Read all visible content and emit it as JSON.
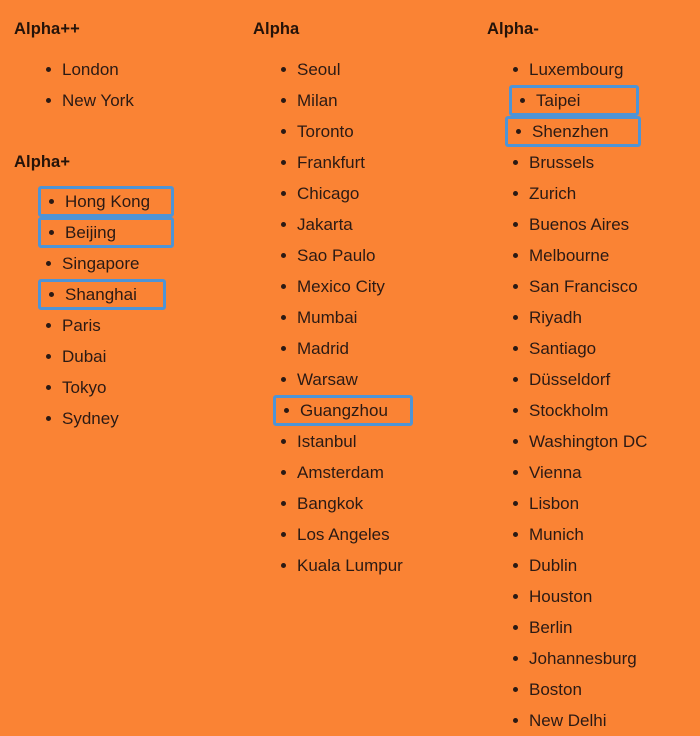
{
  "page": {
    "background_color": "#fa8334",
    "text_color": "#2b1a14",
    "highlight_color": "#4e94d6"
  },
  "columns": [
    {
      "id": "col-0",
      "groups": [
        {
          "heading": "Alpha++",
          "cities": [
            {
              "name": "London",
              "highlighted": false
            },
            {
              "name": "New York",
              "highlighted": false
            }
          ]
        },
        {
          "heading": "Alpha+",
          "cities": [
            {
              "name": "Hong Kong",
              "highlighted": true
            },
            {
              "name": "Beijing",
              "highlighted": true
            },
            {
              "name": "Singapore",
              "highlighted": false
            },
            {
              "name": "Shanghai",
              "highlighted": true
            },
            {
              "name": "Paris",
              "highlighted": false
            },
            {
              "name": "Dubai",
              "highlighted": false
            },
            {
              "name": "Tokyo",
              "highlighted": false
            },
            {
              "name": "Sydney",
              "highlighted": false
            }
          ]
        }
      ]
    },
    {
      "id": "col-1",
      "groups": [
        {
          "heading": "Alpha",
          "cities": [
            {
              "name": "Seoul",
              "highlighted": false
            },
            {
              "name": "Milan",
              "highlighted": false
            },
            {
              "name": "Toronto",
              "highlighted": false
            },
            {
              "name": "Frankfurt",
              "highlighted": false
            },
            {
              "name": "Chicago",
              "highlighted": false
            },
            {
              "name": "Jakarta",
              "highlighted": false
            },
            {
              "name": "Sao Paulo",
              "highlighted": false
            },
            {
              "name": "Mexico City",
              "highlighted": false
            },
            {
              "name": "Mumbai",
              "highlighted": false
            },
            {
              "name": "Madrid",
              "highlighted": false
            },
            {
              "name": "Warsaw",
              "highlighted": false
            },
            {
              "name": "Guangzhou",
              "highlighted": true
            },
            {
              "name": "Istanbul",
              "highlighted": false
            },
            {
              "name": "Amsterdam",
              "highlighted": false
            },
            {
              "name": "Bangkok",
              "highlighted": false
            },
            {
              "name": "Los Angeles",
              "highlighted": false
            },
            {
              "name": "Kuala Lumpur",
              "highlighted": false
            }
          ]
        }
      ]
    },
    {
      "id": "col-2",
      "groups": [
        {
          "heading": "Alpha-",
          "cities": [
            {
              "name": "Luxembourg",
              "highlighted": false
            },
            {
              "name": "Taipei",
              "highlighted": true
            },
            {
              "name": "Shenzhen",
              "highlighted": true
            },
            {
              "name": "Brussels",
              "highlighted": false
            },
            {
              "name": "Zurich",
              "highlighted": false
            },
            {
              "name": "Buenos Aires",
              "highlighted": false
            },
            {
              "name": "Melbourne",
              "highlighted": false
            },
            {
              "name": "San Francisco",
              "highlighted": false
            },
            {
              "name": "Riyadh",
              "highlighted": false
            },
            {
              "name": "Santiago",
              "highlighted": false
            },
            {
              "name": "Düsseldorf",
              "highlighted": false
            },
            {
              "name": "Stockholm",
              "highlighted": false
            },
            {
              "name": "Washington DC",
              "highlighted": false
            },
            {
              "name": "Vienna",
              "highlighted": false
            },
            {
              "name": "Lisbon",
              "highlighted": false
            },
            {
              "name": "Munich",
              "highlighted": false
            },
            {
              "name": "Dublin",
              "highlighted": false
            },
            {
              "name": "Houston",
              "highlighted": false
            },
            {
              "name": "Berlin",
              "highlighted": false
            },
            {
              "name": "Johannesburg",
              "highlighted": false
            },
            {
              "name": "Boston",
              "highlighted": false
            },
            {
              "name": "New Delhi",
              "highlighted": false
            }
          ]
        }
      ]
    }
  ]
}
